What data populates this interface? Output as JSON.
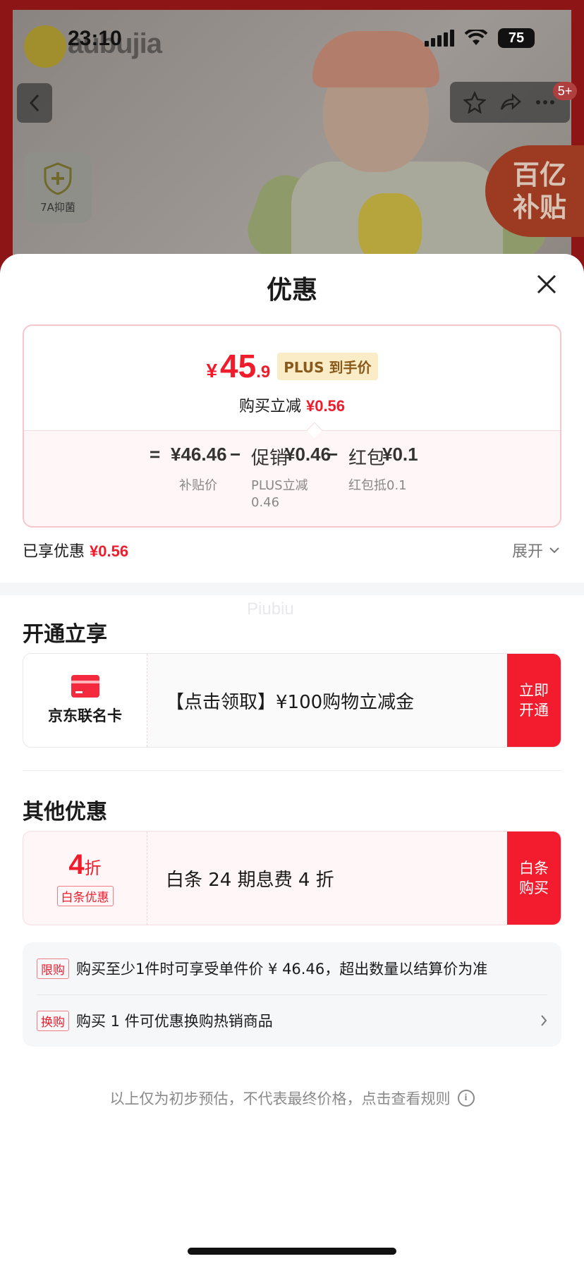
{
  "status_bar": {
    "time": "23:10",
    "battery": "75"
  },
  "background": {
    "brand_text": "aubujia",
    "shield_label": "7A抑菌",
    "subsidy_line1": "百亿",
    "subsidy_line2": "补贴",
    "notification_badge": "5+"
  },
  "sheet": {
    "title": "优惠",
    "price": {
      "currency": "¥",
      "integer": "45",
      "decimal": ".9",
      "tag": "PLUS 到手价",
      "reduce_label": "购买立减",
      "reduce_value": "¥0.56"
    },
    "formula": {
      "equals": "=",
      "base_price": "¥46.46",
      "base_label": "补贴价",
      "minus1": "−",
      "promo_label": "促销",
      "promo_value": "¥0.46",
      "promo_note_line1": "PLUS立减",
      "promo_note_line2": "0.46",
      "minus2": "−",
      "redpack_label": "红包",
      "redpack_value": "¥0.1",
      "redpack_note": "红包抵0.1"
    },
    "enjoyed_label": "已享优惠",
    "enjoyed_value": "¥0.56",
    "expand_label": "展开",
    "watermark": "Piubiu",
    "open_section": {
      "title": "开通立享",
      "card_name": "京东联名卡",
      "offer_text": "【点击领取】¥100购物立减金",
      "button_label": "立即开通"
    },
    "other_section": {
      "title": "其他优惠",
      "discount_value": "4",
      "discount_unit": "折",
      "discount_tag": "白条优惠",
      "offer_text": "白条 24 期息费 4 折",
      "button_label": "白条购买"
    },
    "rules": [
      {
        "tag": "限购",
        "text": "购买至少1件时可享受单件价 ¥ 46.46，超出数量以结算价为准"
      },
      {
        "tag": "换购",
        "text": "购买 1 件可优惠换购热销商品"
      }
    ],
    "footnote": "以上仅为初步预估，不代表最终价格，点击查看规则"
  },
  "colors": {
    "accent_red": "#f01c2c",
    "plus_gold_bg": "#fbecc8",
    "card_border_pink": "#f7c6cc"
  }
}
